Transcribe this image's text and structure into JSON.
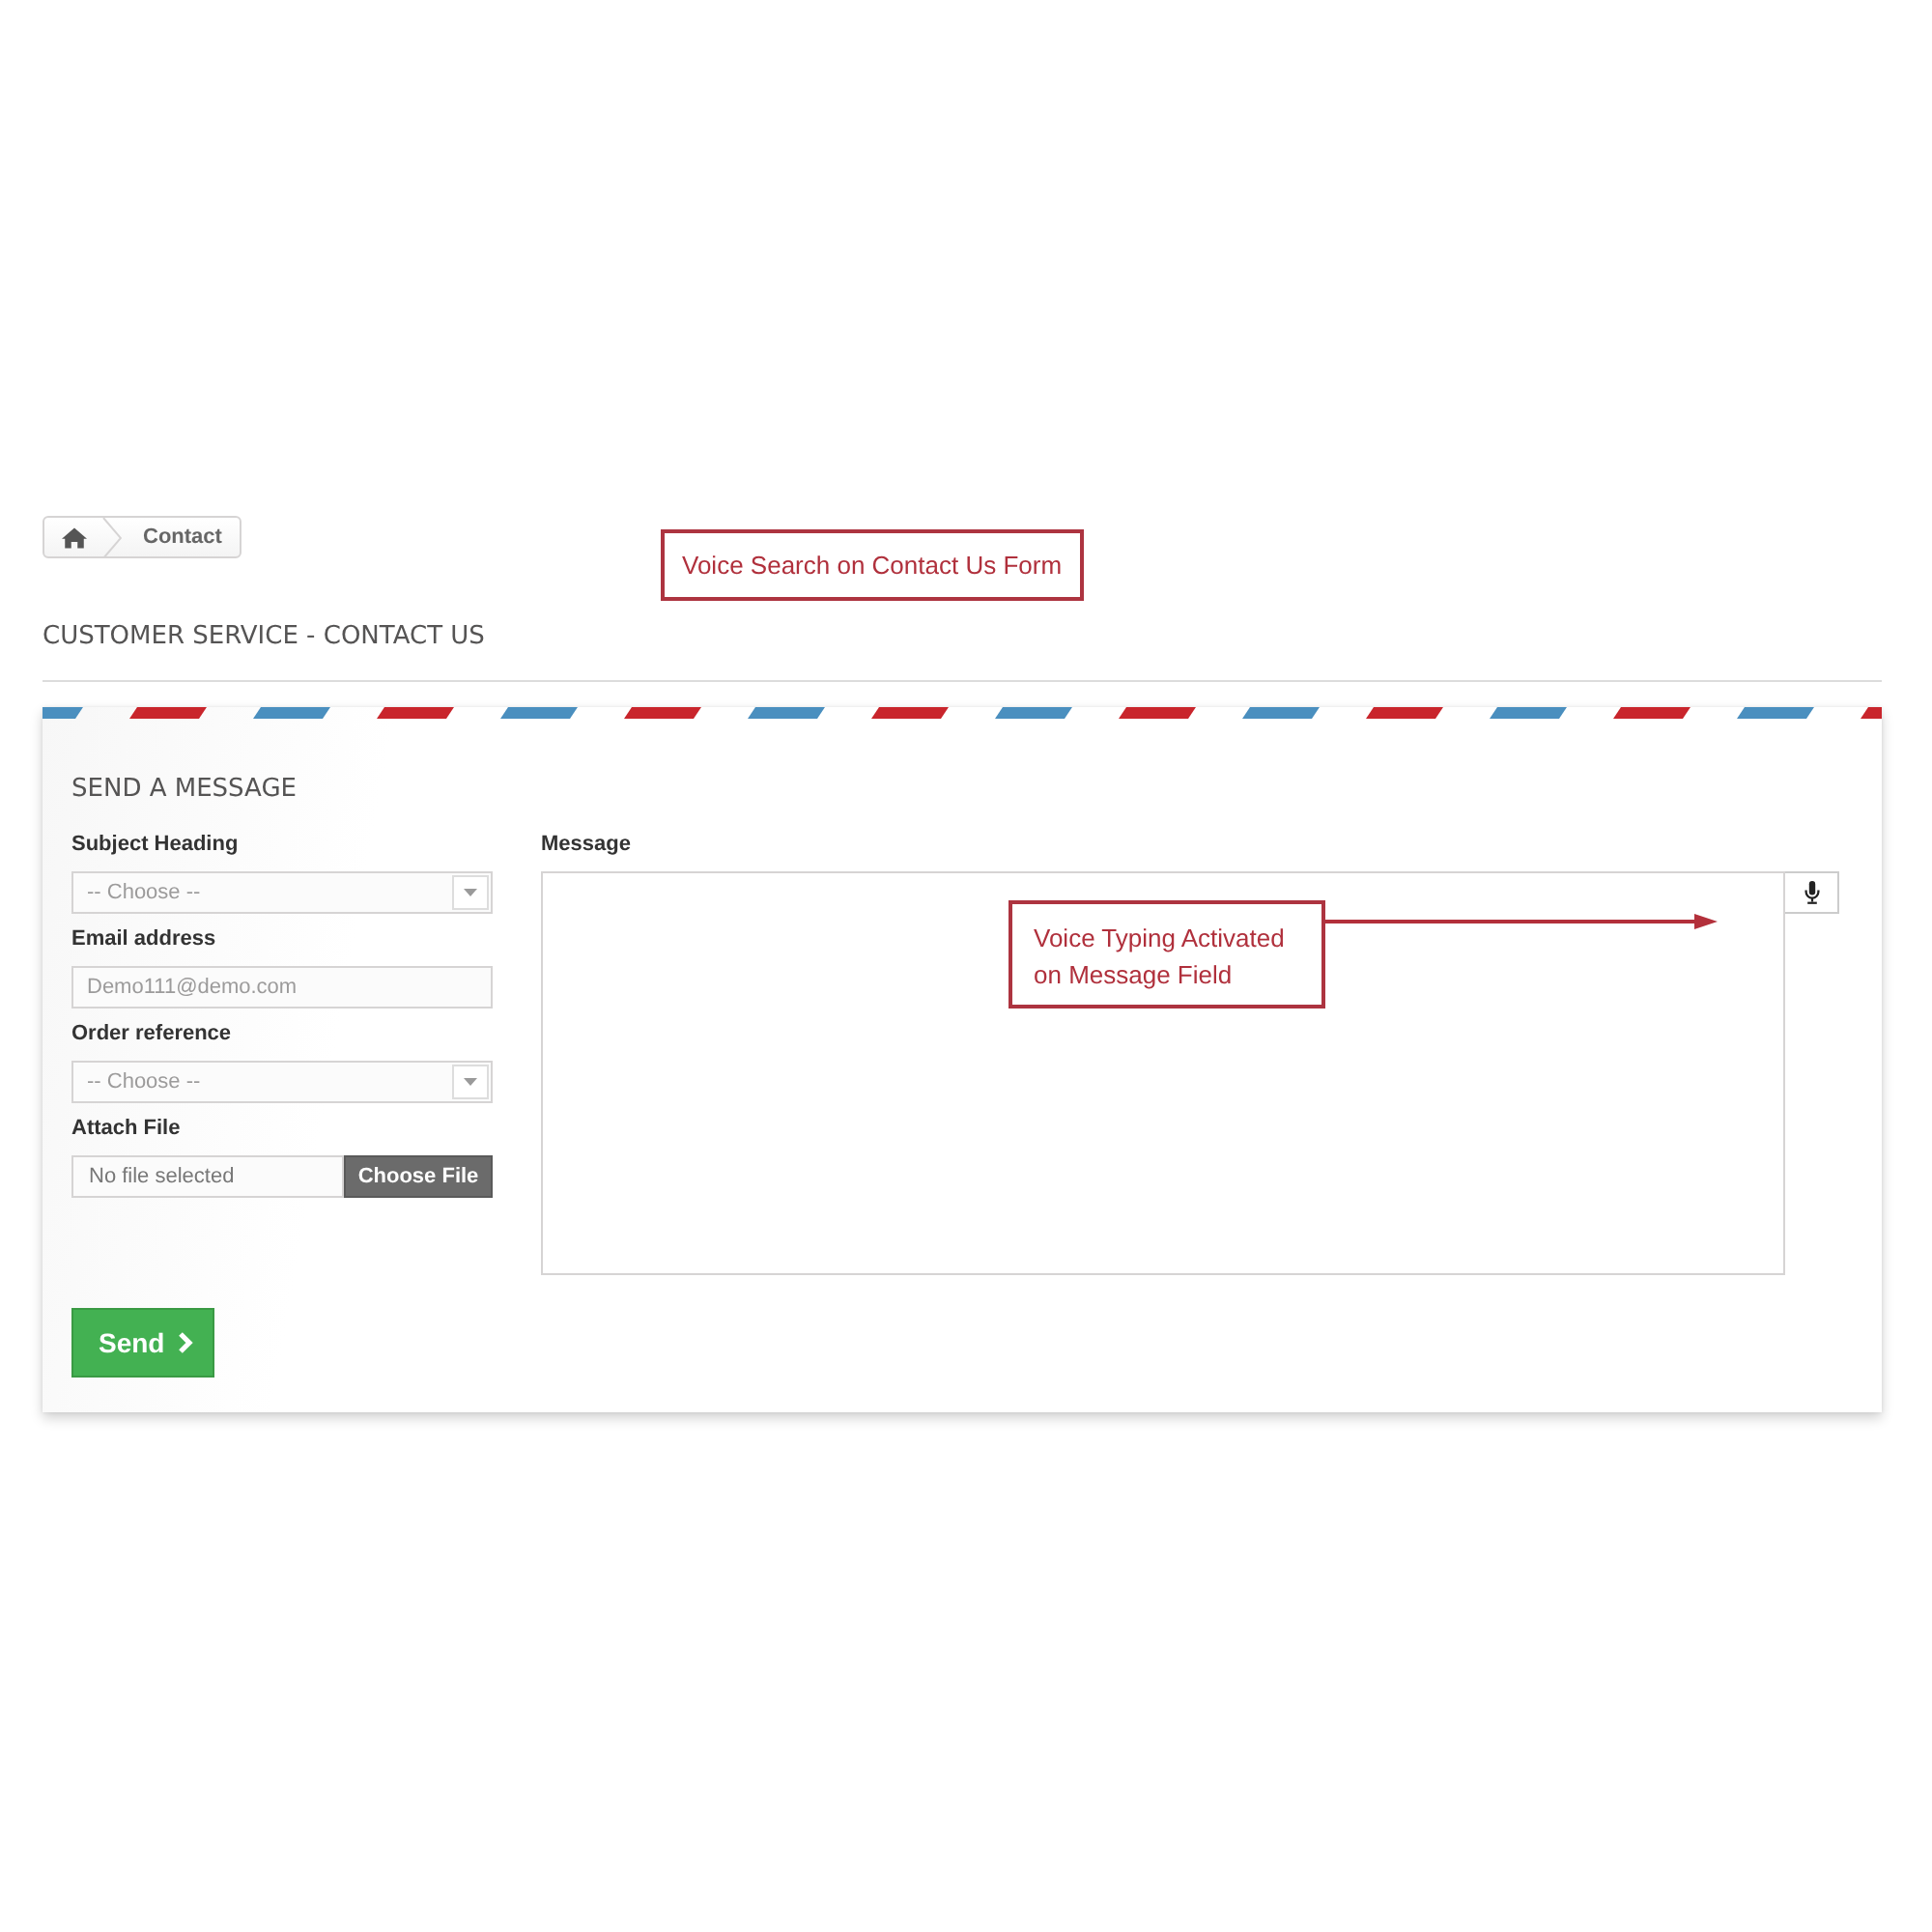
{
  "breadcrumb": {
    "current": "Contact"
  },
  "annotations": [
    {
      "kind": "box",
      "text": "Voice Search on Contact Us Form"
    },
    {
      "kind": "arrow",
      "text": "Voice Typing Activated\non Message Field"
    }
  ],
  "page_title": "CUSTOMER SERVICE - CONTACT US",
  "form": {
    "heading": "SEND A MESSAGE",
    "fields": [
      {
        "kind": "select",
        "label": "Subject Heading",
        "value": "-- Choose --"
      },
      {
        "kind": "email",
        "label": "Email address",
        "value": "Demo111@demo.com"
      },
      {
        "kind": "select",
        "label": "Order reference",
        "value": "-- Choose --"
      },
      {
        "kind": "file",
        "label": "Attach File",
        "value": "No file selected",
        "button": "Choose File"
      }
    ],
    "message": {
      "label": "Message"
    },
    "submit": "Send"
  }
}
